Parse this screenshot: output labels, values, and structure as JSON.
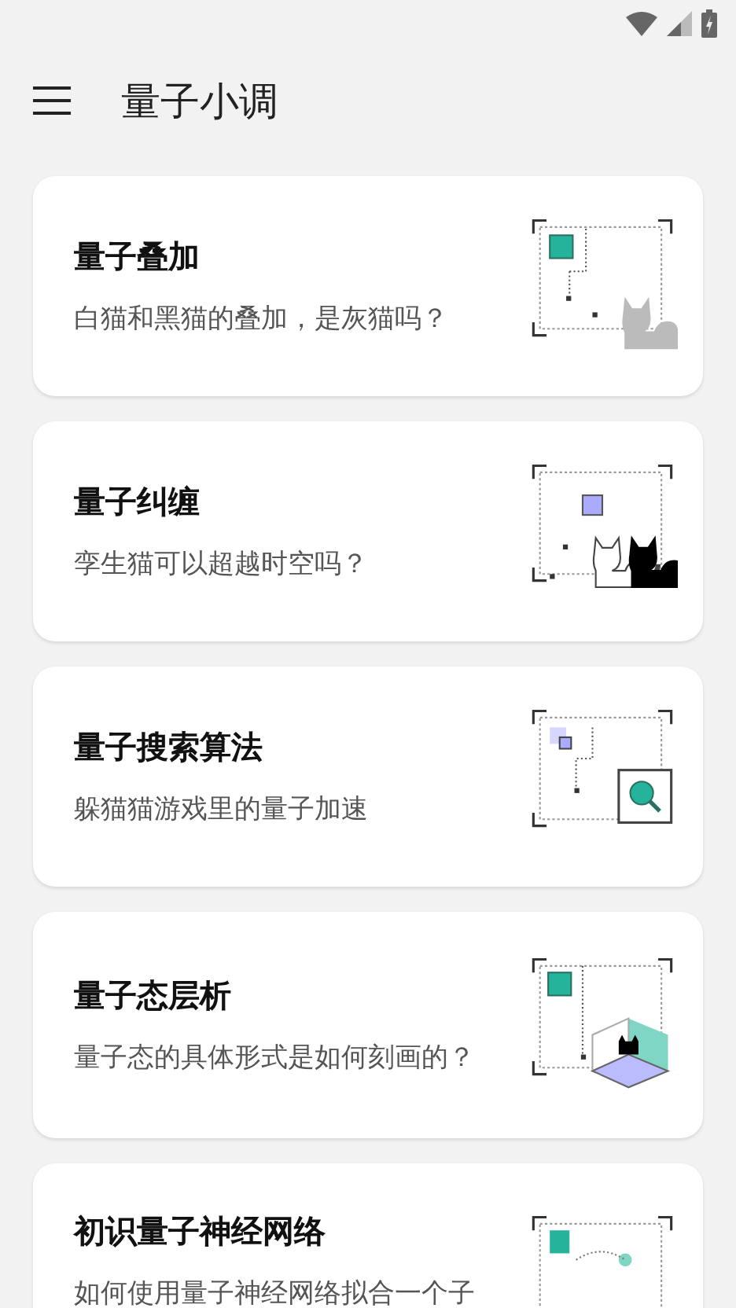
{
  "app_bar": {
    "title": "量子小调"
  },
  "cards": [
    {
      "title": "量子叠加",
      "subtitle": "白猫和黑猫的叠加，是灰猫吗？",
      "kind": "superposition"
    },
    {
      "title": "量子纠缠",
      "subtitle": "孪生猫可以超越时空吗？",
      "kind": "entanglement"
    },
    {
      "title": "量子搜索算法",
      "subtitle": "躲猫猫游戏里的量子加速",
      "kind": "search"
    },
    {
      "title": "量子态层析",
      "subtitle": "量子态的具体形式是如何刻画的？",
      "kind": "tomography"
    },
    {
      "title": "初识量子神经网络",
      "subtitle": "如何使用量子神经网络拟合一个子",
      "kind": "network"
    }
  ]
}
